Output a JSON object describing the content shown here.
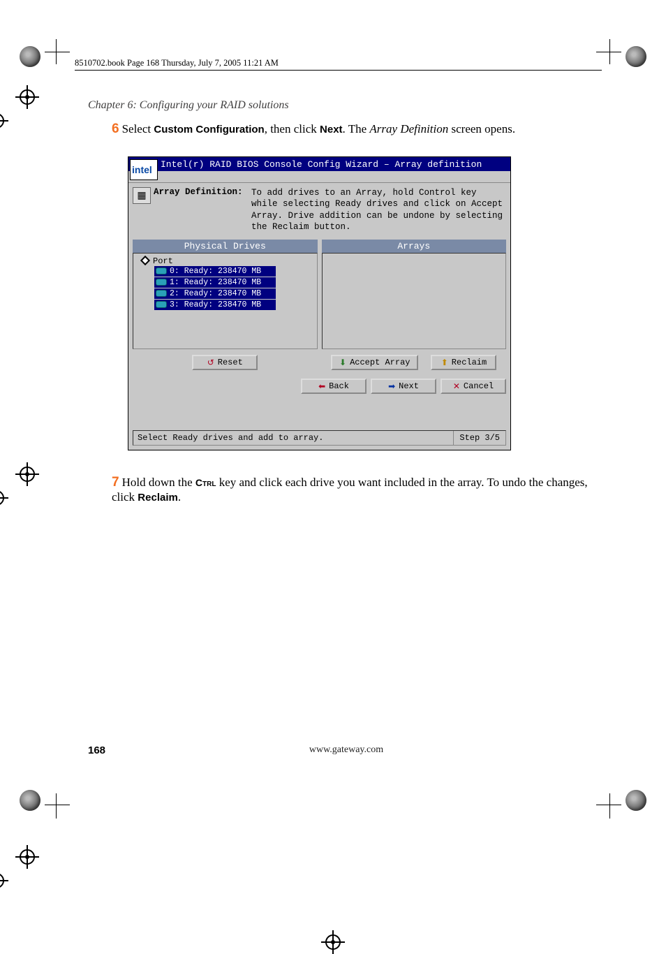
{
  "header_line": "8510702.book  Page 168  Thursday, July 7, 2005  11:21 AM",
  "chapter_title": "Chapter 6: Configuring your RAID solutions",
  "step6": {
    "num": "6",
    "pre": "Select ",
    "bold1": "Custom Configuration",
    "mid": ", then click ",
    "bold2": "Next",
    "post1": ". The ",
    "italic": "Array Definition",
    "post2": " screen opens."
  },
  "screenshot": {
    "title": "Intel(r) RAID BIOS Console  Config Wizard – Array definition",
    "logo": "intel",
    "defn_label": "Array Definition:",
    "defn_text": "To add drives to an Array, hold Control key while selecting Ready drives and click on Accept Array. Drive addition can be undone by selecting the Reclaim button.",
    "left_header": "Physical Drives",
    "right_header": "Arrays",
    "port_label": "Port",
    "drives": [
      "0: Ready: 238470 MB",
      "1: Ready: 238470 MB",
      "2: Ready: 238470 MB",
      "3: Ready: 238470 MB"
    ],
    "btn_reset": "Reset",
    "btn_accept": "Accept Array",
    "btn_reclaim": "Reclaim",
    "btn_back": "Back",
    "btn_next": "Next",
    "btn_cancel": "Cancel",
    "status_left": "Select Ready drives and add to array.",
    "status_right": "Step 3/5"
  },
  "step7": {
    "num": "7",
    "pre": "Hold down the ",
    "caps": "Ctrl",
    "mid": " key and click each drive you want included in the array. To undo the changes, click ",
    "bold": "Reclaim",
    "post": "."
  },
  "footer": {
    "page_num": "168",
    "url": "www.gateway.com"
  }
}
